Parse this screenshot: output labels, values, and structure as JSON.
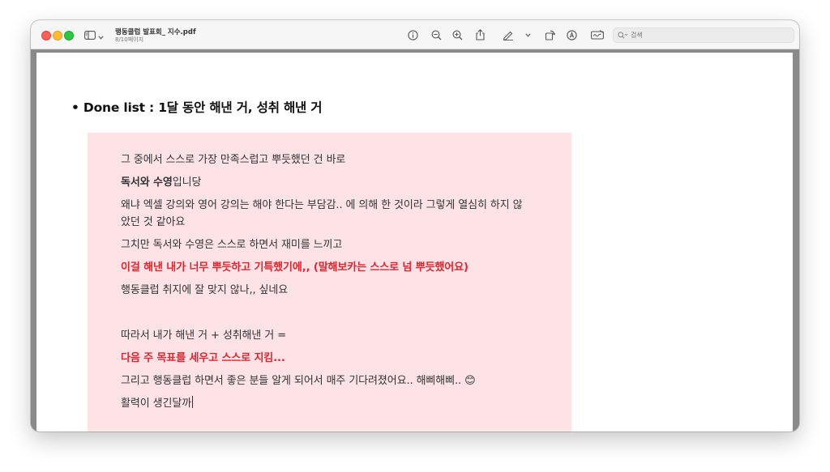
{
  "window": {
    "doc_title": "행동클럽 발표회_ 지수.pdf",
    "page_indicator": "8/10페이지",
    "search_placeholder": "검색"
  },
  "page": {
    "heading": "• Done list : 1달 동안 해낸 거, 성취 해낸 거",
    "lines": {
      "l1": "그 중에서 스스로 가장 만족스럽고 뿌듯했던 건 바로",
      "l2_bold": "독서와 수영",
      "l2_rest": "입니당",
      "l3a": "왜냐 엑셀 강의와 영어 강의는 해야 한다는 부담감.. 에 의해 한 것이라 그렇게 열심히 하지 않",
      "l3b": "았던 것 같아요",
      "l4": "그치만 독서와 수영은 스스로 하면서 재미를 느끼고",
      "l5": "이걸 해낸 내가 너무 뿌듯하고 기특했기에,, (말해보카는 스스로 넘 뿌듯했어요)",
      "l6": "행동클럽 취지에 잘 맞지 않나,, 싶네요",
      "l7": "따라서 내가 해낸 거 + 성취해낸 거 =",
      "l8": "다음 주 목표를 세우고 스스로 지킴...",
      "l9": "그리고 행동클럽 하면서 좋은 분들 알게 되어서 매주 기다려졌어요.. 해삐해삐.. 😊",
      "l10": "활력이 생긴달까"
    }
  },
  "colors": {
    "highlight_box": "#fde3e6",
    "emphasis_red": "#e0252f"
  },
  "icons": [
    "sidebar-icon",
    "chevron-down-icon",
    "info-icon",
    "zoom-out-icon",
    "zoom-in-icon",
    "share-icon",
    "markup-pen-icon",
    "chevron-down-icon",
    "rotate-icon",
    "highlight-icon",
    "signature-icon",
    "search-icon"
  ]
}
